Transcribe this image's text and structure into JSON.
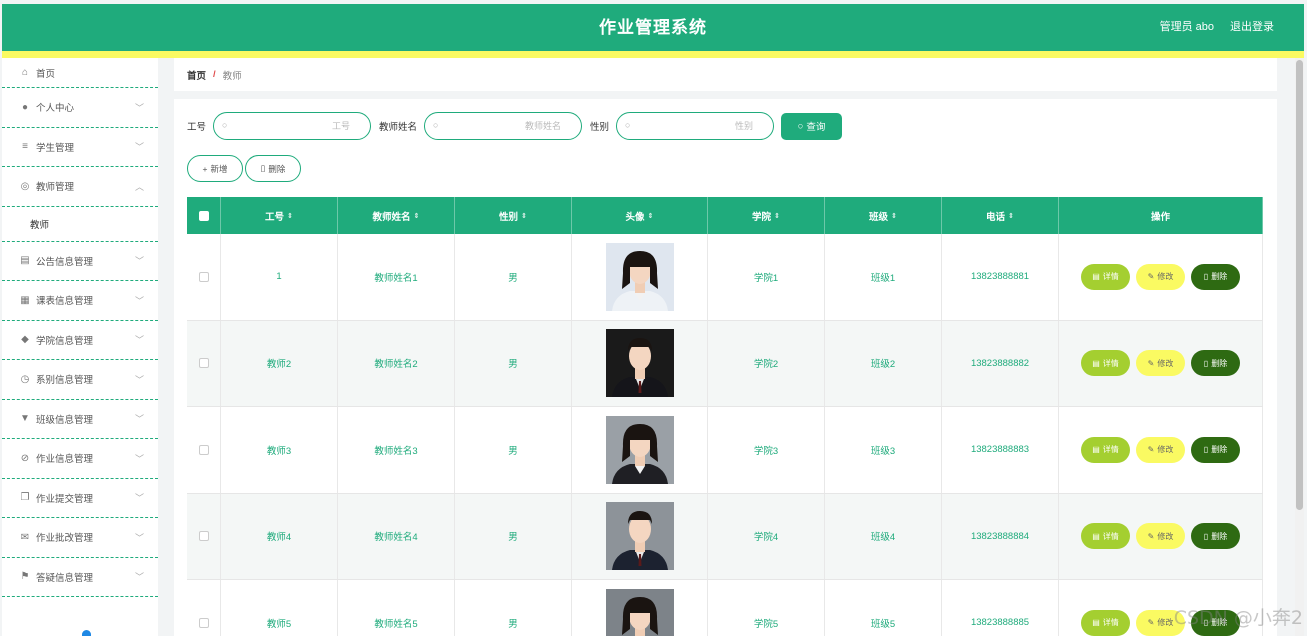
{
  "header": {
    "title": "作业管理系统",
    "user": "管理员 abo",
    "logout": "退出登录"
  },
  "sidebar": {
    "items": [
      {
        "label": "首页",
        "icon": "home-icon",
        "glyph": "⌂",
        "chevron": false
      },
      {
        "label": "个人中心",
        "icon": "user-icon",
        "glyph": "●",
        "chevron": true
      },
      {
        "label": "学生管理",
        "icon": "list-icon",
        "glyph": "≡",
        "chevron": true
      },
      {
        "label": "教师管理",
        "icon": "globe-icon",
        "glyph": "◎",
        "chevron": true,
        "expanded": true,
        "children": [
          "教师"
        ]
      },
      {
        "label": "公告信息管理",
        "icon": "clipboard-icon",
        "glyph": "▤",
        "chevron": true
      },
      {
        "label": "课表信息管理",
        "icon": "grid-icon",
        "glyph": "▦",
        "chevron": true
      },
      {
        "label": "学院信息管理",
        "icon": "pin-icon",
        "glyph": "◆",
        "chevron": true
      },
      {
        "label": "系别信息管理",
        "icon": "clock-icon",
        "glyph": "◷",
        "chevron": true
      },
      {
        "label": "班级信息管理",
        "icon": "flag-icon",
        "glyph": "▼",
        "chevron": true
      },
      {
        "label": "作业信息管理",
        "icon": "bell-off-icon",
        "glyph": "⊘",
        "chevron": true
      },
      {
        "label": "作业提交管理",
        "icon": "copy-icon",
        "glyph": "❐",
        "chevron": true
      },
      {
        "label": "作业批改管理",
        "icon": "mail-icon",
        "glyph": "✉",
        "chevron": true
      },
      {
        "label": "答疑信息管理",
        "icon": "flag-icon",
        "glyph": "⚑",
        "chevron": true
      }
    ]
  },
  "breadcrumb": {
    "home": "首页",
    "separator": "/",
    "current": "教师"
  },
  "search": {
    "fields": [
      {
        "label": "工号",
        "placeholder": "工号"
      },
      {
        "label": "教师姓名",
        "placeholder": "教师姓名"
      },
      {
        "label": "性别",
        "placeholder": "性别"
      }
    ],
    "query_label": "查询"
  },
  "actions": {
    "add_label": "新增",
    "delete_label": "删除"
  },
  "table": {
    "columns": [
      "工号",
      "教师姓名",
      "性别",
      "头像",
      "学院",
      "班级",
      "电话",
      "操作"
    ],
    "rows": [
      {
        "id": "1",
        "name": "教师姓名1",
        "sex": "男",
        "college": "学院1",
        "class": "班级1",
        "phone": "13823888881",
        "avatar": {
          "gender": "f",
          "bg": "#dfe6ef",
          "cloth": "#eef2f6"
        }
      },
      {
        "id": "教师2",
        "name": "教师姓名2",
        "sex": "男",
        "college": "学院2",
        "class": "班级2",
        "phone": "13823888882",
        "avatar": {
          "gender": "m",
          "bg": "#1a1a1a",
          "cloth": "#15151a"
        }
      },
      {
        "id": "教师3",
        "name": "教师姓名3",
        "sex": "男",
        "college": "学院3",
        "class": "班级3",
        "phone": "13823888883",
        "avatar": {
          "gender": "f",
          "bg": "#9aa0a6",
          "cloth": "#1f1f24"
        }
      },
      {
        "id": "教师4",
        "name": "教师姓名4",
        "sex": "男",
        "college": "学院4",
        "class": "班级4",
        "phone": "13823888884",
        "avatar": {
          "gender": "m",
          "bg": "#8d9399",
          "cloth": "#1c2230"
        }
      },
      {
        "id": "教师5",
        "name": "教师姓名5",
        "sex": "男",
        "college": "学院5",
        "class": "班级5",
        "phone": "13823888885",
        "avatar": {
          "gender": "f",
          "bg": "#7d8389",
          "cloth": "#1a1a1e"
        }
      }
    ],
    "row_actions": {
      "detail": "详情",
      "edit": "修改",
      "delete": "删除"
    }
  },
  "watermark": "CSDN @小奔2",
  "colors": {
    "primary": "#1fab7c",
    "accent_yellow": "#fafa62",
    "detail_btn": "#a4cf30",
    "delete_btn": "#2e6a12"
  }
}
